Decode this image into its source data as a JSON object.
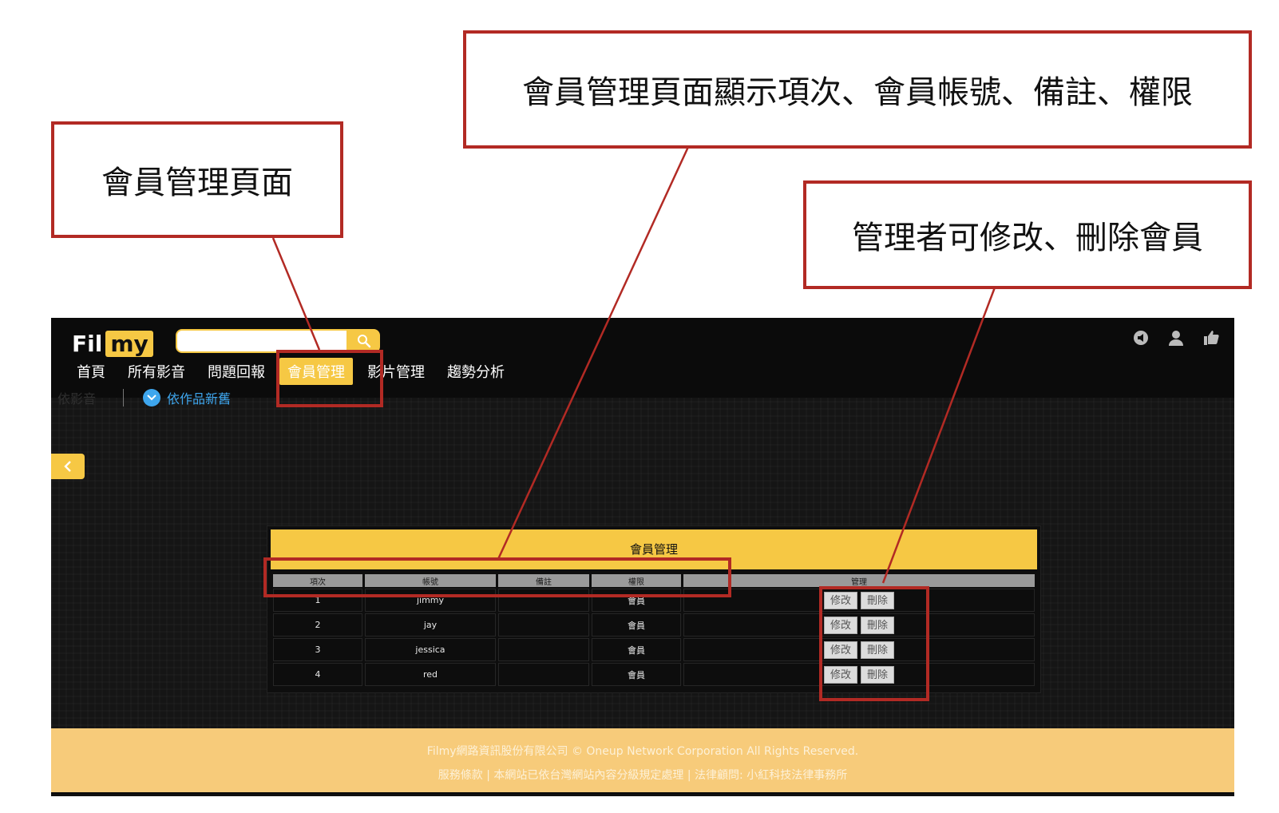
{
  "callouts": {
    "page": "會員管理頁面",
    "columns": "會員管理頁面顯示項次、會員帳號、備註、權限",
    "actions": "管理者可修改、刪除會員"
  },
  "header": {
    "logo_left": "Fil",
    "logo_right": "my",
    "search_placeholder": "",
    "nav": [
      "首頁",
      "所有影音",
      "問題回報",
      "會員管理",
      "影片管理",
      "趨勢分析"
    ],
    "active_nav": "會員管理",
    "icons": [
      "speaker-icon",
      "user-icon",
      "thumbs-up-icon"
    ]
  },
  "subbar": {
    "faded_label": "依影音",
    "filter_label": "依作品新舊"
  },
  "table": {
    "title": "會員管理",
    "headers": [
      "項次",
      "帳號",
      "備註",
      "權限",
      "管理"
    ],
    "rows": [
      {
        "index": "1",
        "account": "jimmy",
        "note": "",
        "role": "會員"
      },
      {
        "index": "2",
        "account": "jay",
        "note": "",
        "role": "會員"
      },
      {
        "index": "3",
        "account": "jessica",
        "note": "",
        "role": "會員"
      },
      {
        "index": "4",
        "account": "red",
        "note": "",
        "role": "會員"
      }
    ],
    "edit_label": "修改",
    "delete_label": "刪除"
  },
  "footer": {
    "line1": "Filmy網路資訊股份有限公司 © Oneup Network Corporation All Rights Reserved.",
    "line2": "服務條款 | 本網站已依台灣網站內容分級規定處理 | 法律顧問: 小紅科技法律事務所"
  },
  "colors": {
    "accent": "#f6c844",
    "annotation": "#b22a24",
    "filter_blue": "#3ea6ee"
  }
}
